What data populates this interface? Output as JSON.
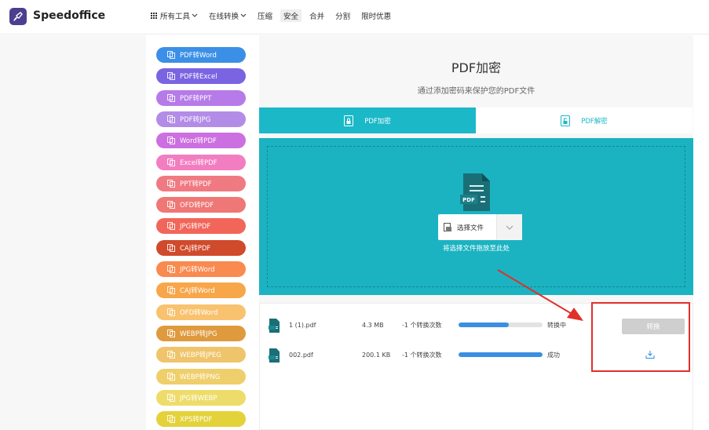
{
  "brand": {
    "name": "Speedoffice",
    "color": "#4b3f8f"
  },
  "nav": {
    "items": [
      {
        "label": "所有工具",
        "has_chevron": true,
        "has_grid": true
      },
      {
        "label": "在线转换",
        "has_chevron": true
      },
      {
        "label": "压缩"
      },
      {
        "label": "安全",
        "active": true
      },
      {
        "label": "合并"
      },
      {
        "label": "分割"
      },
      {
        "label": "限时优惠"
      }
    ]
  },
  "sidebar": {
    "items": [
      {
        "label": "PDF转Word",
        "color": "#3b8fe6"
      },
      {
        "label": "PDF转Excel",
        "color": "#7a64e2"
      },
      {
        "label": "PDF转PPT",
        "color": "#b67be8"
      },
      {
        "label": "PDF转JPG",
        "color": "#b28ce6"
      },
      {
        "label": "Word转PDF",
        "color": "#cc6fe0"
      },
      {
        "label": "Excel转PDF",
        "color": "#f27ec1"
      },
      {
        "label": "PPT转PDF",
        "color": "#f07a82"
      },
      {
        "label": "OFD转PDF",
        "color": "#ef7775"
      },
      {
        "label": "JPG转PDF",
        "color": "#f2665a"
      },
      {
        "label": "CAJ转PDF",
        "color": "#d04a2c"
      },
      {
        "label": "JPG转Word",
        "color": "#f98a50"
      },
      {
        "label": "CAJ转Word",
        "color": "#f7a64a"
      },
      {
        "label": "OFD转Word",
        "color": "#f8c26e"
      },
      {
        "label": "WEBP转JPG",
        "color": "#df9a3e"
      },
      {
        "label": "WEBP转JPEG",
        "color": "#efc46a"
      },
      {
        "label": "WEBP转PNG",
        "color": "#efcf6b"
      },
      {
        "label": "JPG转WEBP",
        "color": "#eedc6a"
      },
      {
        "label": "XPS转PDF",
        "color": "#e4d23a"
      }
    ]
  },
  "page": {
    "title": "PDF加密",
    "subtitle": "通过添加密码来保护您的PDF文件"
  },
  "tabs": [
    {
      "label": "PDF加密",
      "active": true
    },
    {
      "label": "PDF解密",
      "active": false
    }
  ],
  "dropzone": {
    "select_label": "选择文件",
    "hint": "将选择文件拖放至此处",
    "icon_text": "PDF"
  },
  "files": [
    {
      "name": "1 (1).pdf",
      "size": "4.3 MB",
      "quota": "-1 个转换次数",
      "progress": 0.6,
      "status": "转换中"
    },
    {
      "name": "002.pdf",
      "size": "200.1 KB",
      "quota": "-1 个转换次数",
      "progress": 1.0,
      "status": "成功"
    }
  ],
  "actions": {
    "convert_label": "转换"
  },
  "colors": {
    "accent": "#1bb8c8",
    "progress": "#3b8fe0",
    "highlight": "#e0302a"
  }
}
